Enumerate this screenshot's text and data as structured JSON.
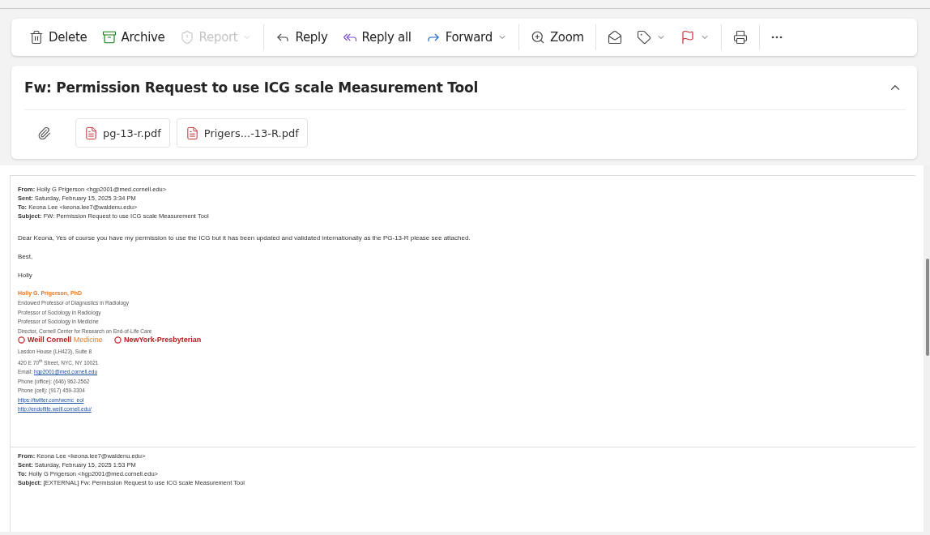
{
  "toolbar": {
    "groups": [
      [
        {
          "label": "Delete",
          "disabled": false,
          "dropdown": false
        },
        {
          "label": "Archive",
          "disabled": false,
          "dropdown": false
        },
        {
          "label": "Report",
          "disabled": true,
          "dropdown": true
        }
      ],
      [
        {
          "label": "Reply",
          "disabled": false,
          "dropdown": false
        },
        {
          "label": "Reply all",
          "disabled": false,
          "dropdown": false
        },
        {
          "label": "Forward",
          "disabled": false,
          "dropdown": true
        }
      ],
      [
        {
          "label": "Zoom",
          "disabled": false,
          "dropdown": false
        }
      ],
      [
        {
          "disabled": false,
          "dropdown": false
        },
        {
          "disabled": false,
          "dropdown": true
        },
        {
          "disabled": false,
          "dropdown": true
        }
      ],
      [
        {
          "disabled": false,
          "dropdown": false
        }
      ],
      [
        {
          "disabled": false,
          "dropdown": false
        }
      ]
    ]
  },
  "message": {
    "subject": "Fw: Permission Request to use ICG scale Measurement Tool",
    "expanded": true,
    "attachments": [
      {
        "name": "pg-13-r.pdf"
      },
      {
        "name": "Prigers...-13-R.pdf"
      }
    ]
  },
  "body": {
    "blocks": [
      {
        "kind": "header",
        "fields": [
          {
            "label": "From:",
            "value": "Holly G Prigerson <hgp2001@med.cornell.edu>"
          },
          {
            "label": "Sent:",
            "value": "Saturday, February 15, 2025 3:34 PM"
          },
          {
            "label": "To:",
            "value": "Keona Lee <keona.lee7@waldenu.edu>"
          },
          {
            "label": "Subject:",
            "value": "FW: Permission Request to use ICG scale Measurement Tool"
          }
        ]
      },
      {
        "kind": "paragraph",
        "text": "Dear Keona,  Yes of course you have my permission to use the ICG but it has been updated and validated internationally as the PG-13-R please see attached."
      },
      {
        "kind": "paragraph",
        "text": "Best,"
      },
      {
        "kind": "paragraph",
        "text": "Holly"
      },
      {
        "kind": "signature",
        "name": "Holly G. Prigerson, PhD",
        "titles": [
          "Endowed Professor of Diagnostics in Radiology",
          "Professor of Sociology in Radiology",
          "Professor of Sociology in Medicine",
          "Director,  Cornell Center for Research on End-of-Life Care"
        ],
        "logos": [
          {
            "strong": "Weill Cornell",
            "light": "Medicine"
          },
          {
            "strong": "NewYork-Presbyterian"
          }
        ],
        "contact": [
          {
            "kind": "text",
            "text": "Lasdon House (LH423), Suite 8"
          },
          {
            "kind": "text",
            "text": "420 E 70$^{th}$ Street, NYC, NY 10021"
          },
          {
            "kind": "labeled_link",
            "label": "Email:",
            "text": "hgp2001@med.cornell.edu"
          },
          {
            "kind": "text",
            "text": "Phone (office): (646) 962-2562"
          },
          {
            "kind": "text",
            "text": "Phone (cell): (917) 459-3304"
          },
          {
            "kind": "link",
            "text": "https://twitter.com/wcmc_eol"
          },
          {
            "kind": "link",
            "text": "http://endoflife.weill.cornell.edu/"
          }
        ]
      },
      {
        "kind": "header",
        "fields": [
          {
            "label": "From:",
            "value": "Keona Lee <keona.lee7@waldenu.edu>"
          },
          {
            "label": "Sent:",
            "value": "Saturday, February 15, 2025 1:53 PM"
          },
          {
            "label": "To:",
            "value": "Holly G Prigerson <hgp2001@med.cornell.edu>"
          },
          {
            "label": "Subject:",
            "value": "[EXTERNAL] Fw: Permission Request to use ICG scale Measurement Tool"
          }
        ]
      }
    ]
  }
}
